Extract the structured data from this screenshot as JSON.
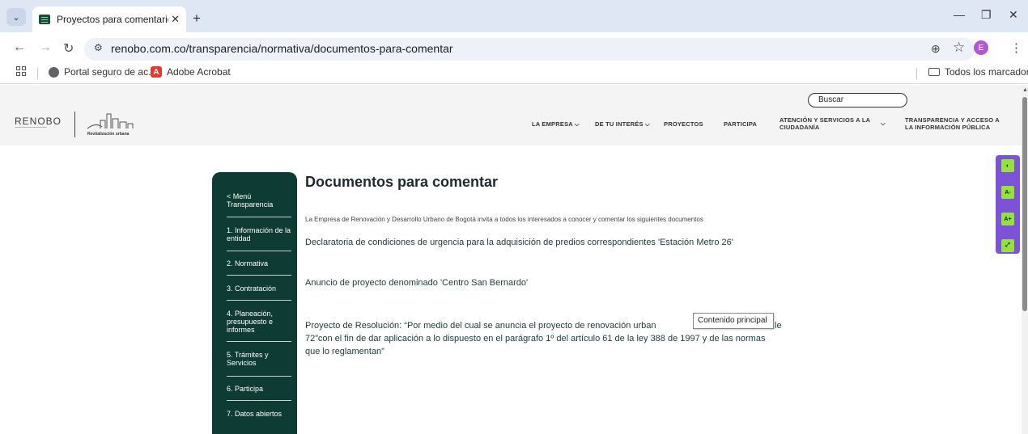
{
  "browser": {
    "tab_title": "Proyectos para comentarios | Re",
    "new_tab_symbol": "+",
    "url": "renobo.com.co/transparencia/normativa/documentos-para-comentar",
    "profile_initial": "E",
    "bookmarks": [
      "Portal seguro de ac...",
      "Adobe Acrobat"
    ],
    "all_bookmarks": "Todos los marcadores"
  },
  "header": {
    "search_placeholder": "Buscar",
    "logo": "RENOBO",
    "logo_sub": "Revitalización urbana",
    "menu": [
      "LA EMPRESA",
      "DE TU INTERÉS",
      "PROYECTOS",
      "PARTICIPA",
      "ATENCIÓN Y SERVICIOS A LA CIUDADANÍA",
      "TRANSPARENCIA Y ACCESO A LA INFORMACIÓN PÚBLICA"
    ]
  },
  "sidebar": {
    "items": [
      "< Menú Transparencia",
      "1. Información de la entidad",
      "2. Normativa",
      "3. Contratación",
      "4. Planeación, presupuesto e informes",
      "5. Trámites y Servicios",
      "6. Participa",
      "7. Datos abiertos"
    ]
  },
  "main": {
    "title": "Documentos para comentar",
    "intro": "La Empresa de Renovación y Desarrollo Urbano de Bogotá invita a todos los interesados a conocer y comentar los siguientes documentos",
    "documents": [
      "Declaratoria de condiciones de urgencia para la adquisición de predios correspondientes 'Estación Metro 26'",
      "Anuncio de proyecto denominado 'Centro San Bernardo'",
      "Proyecto de Resolución: “Por medio del cual se anuncia el proyecto de renovación urban",
      "le",
      "72”con el fin de dar aplicación a lo dispuesto en el parágrafo 1º del artículo 61 de la ley 388 de 1997 y de las normas",
      "que lo reglamentan”"
    ],
    "tooltip": "Contenido principal"
  },
  "a11y": {
    "buttons": [
      "A-",
      "A+"
    ]
  },
  "colors": {
    "sidebar_bg": "#0e3b33",
    "a11y_bg": "#7b52d8",
    "a11y_btn": "#93e33a"
  }
}
